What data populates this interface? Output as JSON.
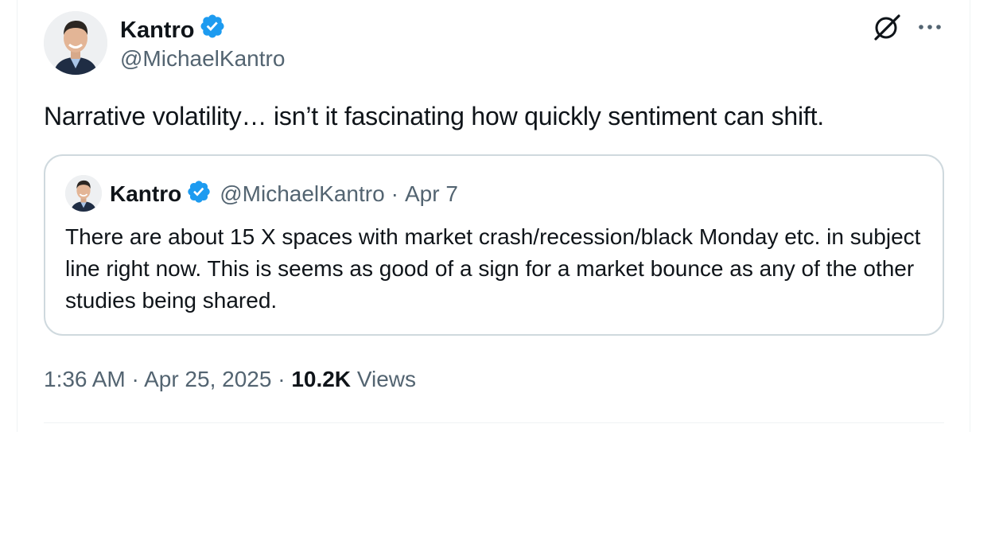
{
  "author": {
    "display_name": "Kantro",
    "handle": "@MichaelKantro",
    "verified": true
  },
  "tweet": {
    "text": "Narrative volatility… isn’t it fascinating how quickly sentiment can shift."
  },
  "quoted_tweet": {
    "display_name": "Kantro",
    "handle": "@MichaelKantro",
    "separator": "·",
    "date": "Apr 7",
    "text": "There are about 15 X spaces with market crash/recession/black Monday etc. in subject line right now. This is seems as good of a sign for a market bounce as any of the other studies being shared."
  },
  "meta": {
    "time": "1:36 AM",
    "separator": "·",
    "date": "Apr 25, 2025",
    "views_count": "10.2K",
    "views_label": "Views"
  },
  "icons": {
    "verified": "verified-badge-icon",
    "grok": "grok-icon",
    "more": "more-options-icon"
  },
  "colors": {
    "verified_blue": "#1d9bf0",
    "secondary_text": "#536471",
    "primary_text": "#0f1419",
    "border": "#cfd9de"
  }
}
